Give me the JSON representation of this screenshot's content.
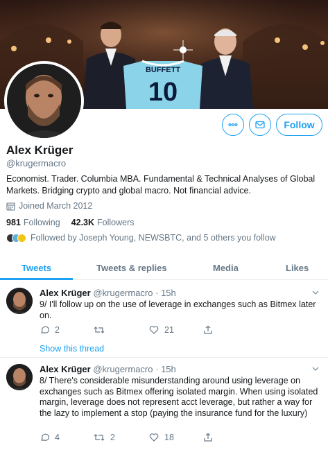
{
  "profile": {
    "name": "Alex Krüger",
    "handle": "@krugermacro",
    "bio": "Economist. Trader. Columbia MBA. Fundamental & Technical Analyses of Global Markets. Bridging crypto and global macro. Not financial advice.",
    "joined": "Joined March 2012",
    "following_count": "981",
    "following_label": "Following",
    "followers_count": "42.3K",
    "followers_label": "Followers",
    "followed_by": "Followed by Joseph Young, NEWSBTC, and 5 others you follow",
    "banner_jersey_name": "BUFFETT",
    "banner_jersey_number": "10"
  },
  "actions": {
    "more_icon": "more-icon",
    "message_icon": "envelope-icon",
    "follow_label": "Follow"
  },
  "tabs": [
    {
      "label": "Tweets",
      "active": true
    },
    {
      "label": "Tweets & replies",
      "active": false
    },
    {
      "label": "Media",
      "active": false
    },
    {
      "label": "Likes",
      "active": false
    }
  ],
  "tweets": [
    {
      "name": "Alex Krüger",
      "handle": "@krugermacro",
      "time": "· 15h",
      "text": "9/ I'll follow up on the use of leverage in exchanges such as Bitmex later on.",
      "replies": "2",
      "retweets": "",
      "likes": "21",
      "thread_link": "Show this thread"
    },
    {
      "name": "Alex Krüger",
      "handle": "@krugermacro",
      "time": "· 15h",
      "text": "8/ There's considerable misunderstanding around using leverage on exchanges such as Bitmex offering isolated margin. When using isolated margin, leverage does not represent acct leverage, but rather a way for the lazy to implement a stop (paying the insurance fund for the luxury)",
      "replies": "4",
      "retweets": "2",
      "likes": "18"
    }
  ],
  "colors": {
    "accent": "#1da1f2",
    "secondary_text": "#657786",
    "border": "#e6ecf0"
  }
}
